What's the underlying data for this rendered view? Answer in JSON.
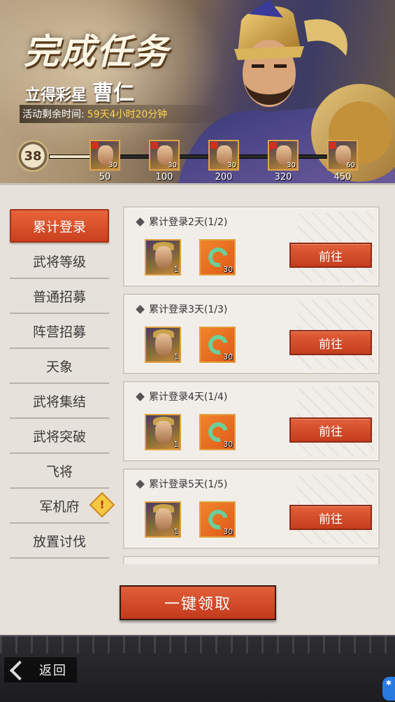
{
  "banner": {
    "title": "完成任务",
    "subtitle_prefix": "立得彩星",
    "hero_name": "曹仁",
    "timer_label": "活动剩余时间:",
    "timer_value": "59天4小时20分钟"
  },
  "progress": {
    "current_level": "38",
    "rewards": [
      {
        "count": "30",
        "milestone": "50"
      },
      {
        "count": "30",
        "milestone": "100"
      },
      {
        "count": "30",
        "milestone": "200"
      },
      {
        "count": "30",
        "milestone": "320"
      },
      {
        "count": "60",
        "milestone": "450"
      }
    ]
  },
  "sidebar": {
    "items": [
      {
        "label": "累计登录"
      },
      {
        "label": "武将等级"
      },
      {
        "label": "普通招募"
      },
      {
        "label": "阵营招募"
      },
      {
        "label": "天象"
      },
      {
        "label": "武将集结"
      },
      {
        "label": "武将突破"
      },
      {
        "label": "飞将"
      },
      {
        "label": "军机府"
      },
      {
        "label": "放置讨伐"
      }
    ],
    "warn_glyph": "!"
  },
  "tasks": [
    {
      "title": "累计登录2天(1/2)",
      "hero_qty": "1",
      "jade_qty": "30",
      "button": "前往"
    },
    {
      "title": "累计登录3天(1/3)",
      "hero_qty": "1",
      "jade_qty": "30",
      "button": "前往"
    },
    {
      "title": "累计登录4天(1/4)",
      "hero_qty": "1",
      "jade_qty": "30",
      "button": "前往"
    },
    {
      "title": "累计登录5天(1/5)",
      "hero_qty": "1",
      "jade_qty": "30",
      "button": "前往"
    }
  ],
  "claim_all": "一键领取",
  "back_label": "返回"
}
